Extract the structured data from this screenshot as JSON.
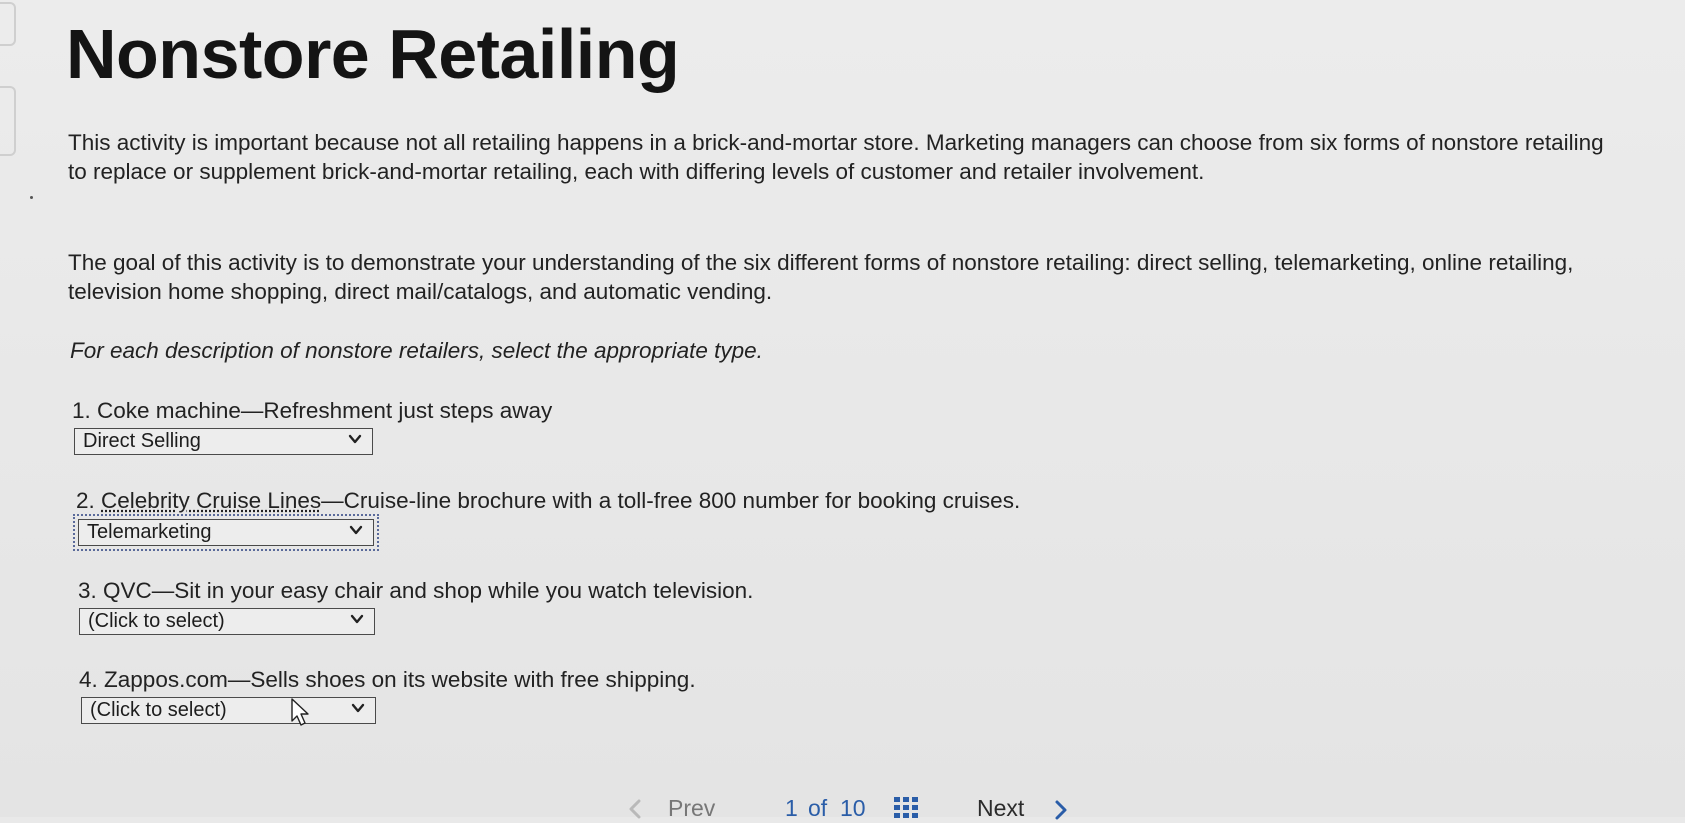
{
  "title": "Nonstore Retailing",
  "intro": {
    "paragraph1": "This activity is important because not all retailing happens in a brick-and-mortar store. Marketing managers can choose from six forms of nonstore retailing to replace or supplement brick-and-mortar retailing, each with differing levels of customer and retailer involvement.",
    "paragraph2": "The goal of this activity is to demonstrate your understanding of the six different forms of nonstore retailing: direct selling, telemarketing, online retailing, television home shopping, direct mail/catalogs, and automatic vending.",
    "instruction": "For each description of nonstore retailers, select the appropriate type."
  },
  "questions": [
    {
      "number": "1.",
      "lead": "Coke machine",
      "text": "—Refreshment just steps away",
      "selected": "Direct Selling"
    },
    {
      "number": "2.",
      "lead": "Celebrity Cruise Lines",
      "text": "—Cruise-line brochure with a toll-free 800 number for booking cruises.",
      "selected": "Telemarketing"
    },
    {
      "number": "3.",
      "lead": "QVC",
      "text": "—Sit in your easy chair and shop while you watch television.",
      "selected": "(Click to select)"
    },
    {
      "number": "4.",
      "lead": "Zappos.com",
      "text": "—Sells shoes on its website with free shipping.",
      "selected": "(Click to select)"
    }
  ],
  "pager": {
    "prev_label": "Prev",
    "current": "1",
    "of_label": "of",
    "total": "10",
    "next_label": "Next"
  },
  "icons": {
    "dropdown": "chevron-down-icon",
    "grid": "grid-icon",
    "prev": "chevron-left-icon",
    "next": "chevron-right-icon",
    "cursor": "mouse-pointer-icon"
  },
  "colors": {
    "background": "#e9e9e9",
    "text": "#1c1c1c",
    "link": "#2a5da8",
    "focus_outline": "#5a6a9a"
  }
}
